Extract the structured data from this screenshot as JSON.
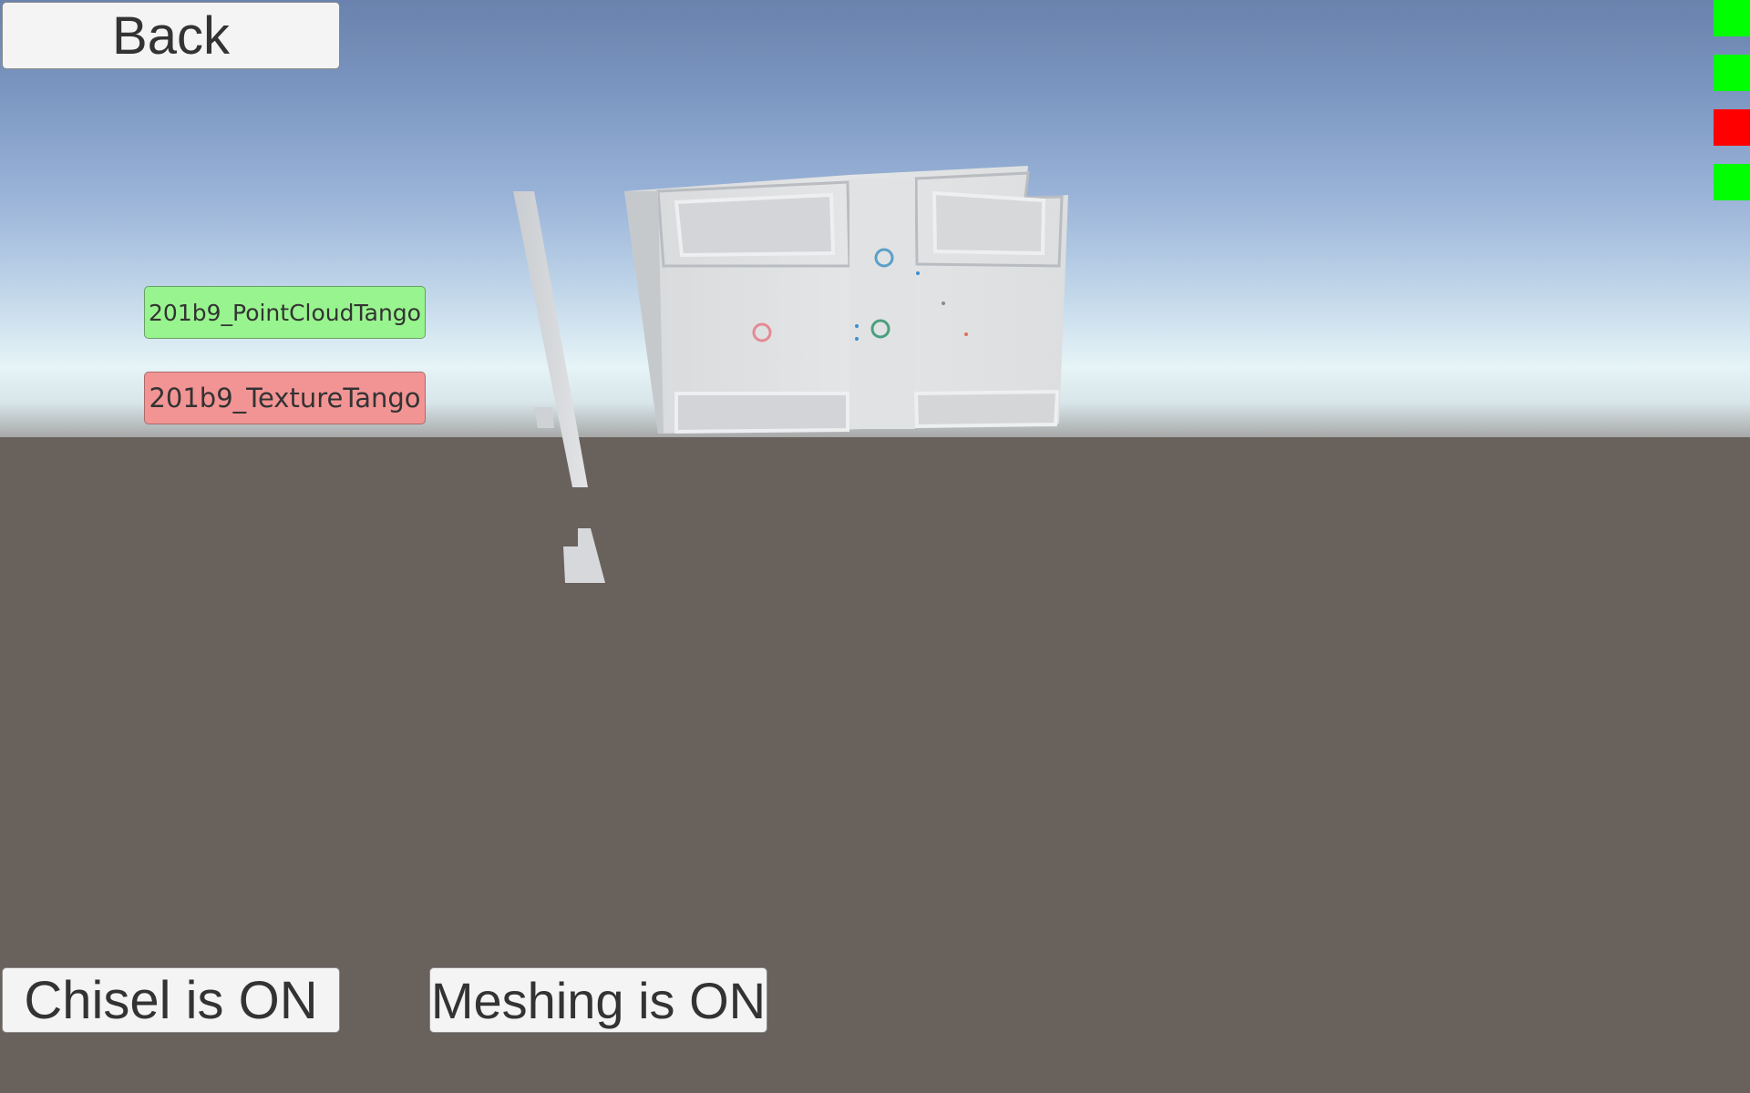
{
  "toolbar": {
    "back_label": "Back"
  },
  "layers": [
    {
      "label": "201b9_PointCloudTango",
      "state": "on",
      "color": "#98f48e"
    },
    {
      "label": "201b9_TextureTango",
      "state": "off",
      "color": "#f39494"
    }
  ],
  "toggles": {
    "chisel_label": "Chisel is ON",
    "meshing_label": "Meshing is ON"
  },
  "status_indicators": [
    {
      "color": "#00ff00"
    },
    {
      "color": "#00ff00"
    },
    {
      "color": "#ff0000"
    },
    {
      "color": "#00ff00"
    }
  ],
  "scene": {
    "object": "door-mesh",
    "sky_color": "#7a95c0",
    "ground_color": "#69615c"
  }
}
